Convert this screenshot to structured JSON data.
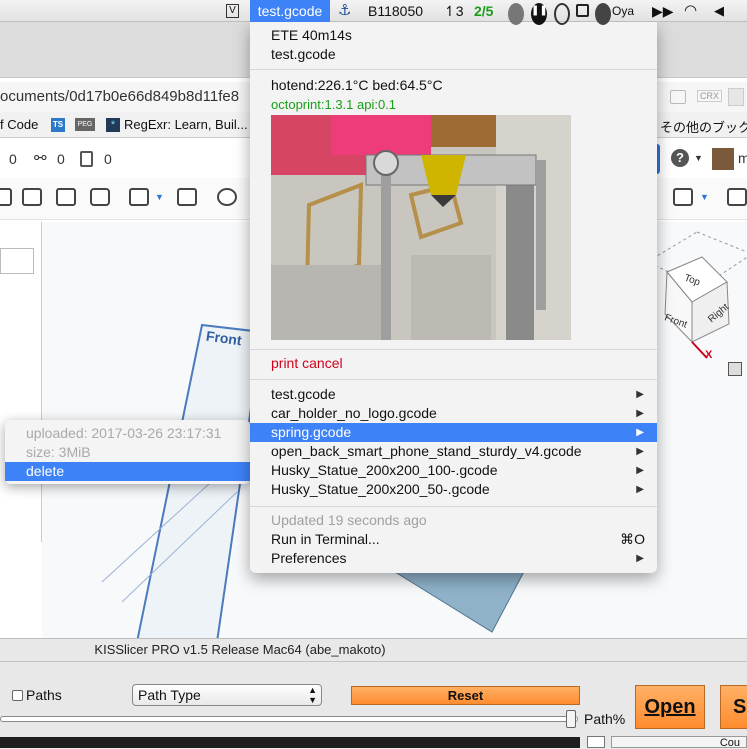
{
  "menubar": {
    "v_icon_label": "V",
    "app_title": "test.gcode",
    "anchor_glyph": "⚓",
    "sensor_text": "B118050",
    "arrow_count": "↿3",
    "fraction": "2/5",
    "user_label": "Oya"
  },
  "browser": {
    "url_text": "ocuments/0d17b0e66d849b8d11fe8",
    "ext_labels": [
      "CRX"
    ],
    "bookmarks": {
      "code": "f Code",
      "ts": "TS",
      "peg": "PEG",
      "regexr": "RegExr: Learn, Buil...",
      "other": "その他のブックマ"
    },
    "stats": {
      "a": "0",
      "b": "0",
      "c": "0"
    },
    "help_glyph": "?",
    "avatar_letter": "m"
  },
  "viewport": {
    "front_label": "Front",
    "cube_top": "Top",
    "cube_front": "Front",
    "cube_right": "Right",
    "axis_x": "X"
  },
  "menu": {
    "ete": "ETE 40m14s",
    "job": "test.gcode",
    "temps": "hotend:226.1°C  bed:64.5°C",
    "version": "octoprint:1.3.1 api:0.1",
    "cancel": "print cancel",
    "files": [
      "test.gcode",
      "car_holder_no_logo.gcode",
      "spring.gcode",
      "open_back_smart_phone_stand_sturdy_v4.gcode",
      "Husky_Statue_200x200_100-.gcode",
      "Husky_Statue_200x200_50-.gcode"
    ],
    "updated": "Updated 19 seconds ago",
    "run_terminal": "Run in Terminal...",
    "run_shortcut": "⌘O",
    "preferences": "Preferences"
  },
  "submenu": {
    "uploaded": "uploaded: 2017-03-26 23:17:31",
    "size": "size: 3MiB",
    "delete": "delete"
  },
  "kisslicer": {
    "title": "KISSlicer PRO v1.5 Release Mac64 (abe_makoto)",
    "paths_label": "Paths",
    "path_type": "Path Type",
    "reset": "Reset",
    "path_percent": "Path%",
    "open": "Open",
    "save_partial": "Sa",
    "bottom_partial": "Cou"
  },
  "colors": {
    "menu_highlight": "#3e82f7",
    "cancel_red": "#d0021b",
    "version_green": "#1a9e1a",
    "reset_orange": "#ff8c2e"
  }
}
